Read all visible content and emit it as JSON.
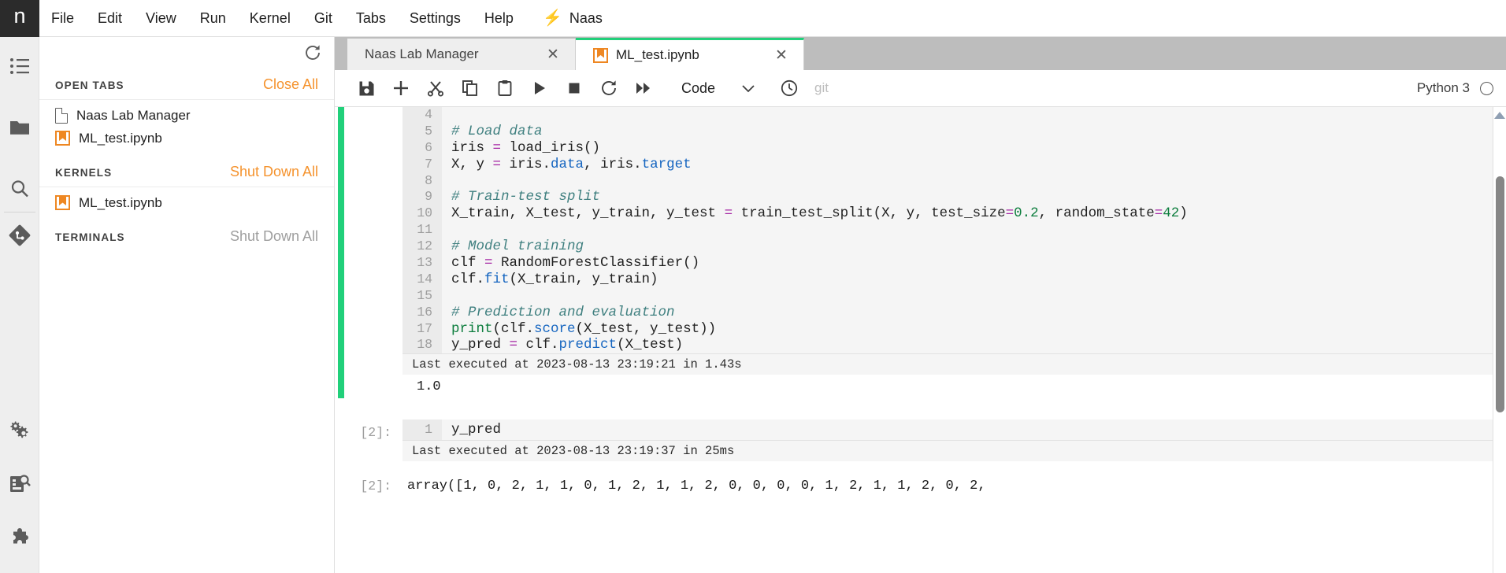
{
  "window": {
    "logo_glyph": "n"
  },
  "menubar": {
    "items": [
      {
        "label": "File"
      },
      {
        "label": "Edit"
      },
      {
        "label": "View"
      },
      {
        "label": "Run"
      },
      {
        "label": "Kernel"
      },
      {
        "label": "Git"
      },
      {
        "label": "Tabs"
      },
      {
        "label": "Settings"
      },
      {
        "label": "Help"
      }
    ],
    "naas": {
      "label": "Naas",
      "icon": "bolt-icon",
      "color": "#f5a623"
    }
  },
  "activitybar": {
    "items": [
      {
        "icon": "list-icon",
        "name": "running-terminals-and-kernels"
      },
      {
        "icon": "folder-icon",
        "name": "file-browser"
      },
      {
        "icon": "search-icon",
        "name": "search"
      },
      {
        "icon": "git-icon",
        "name": "git"
      },
      {
        "icon": "gears-icon",
        "name": "extension-settings"
      },
      {
        "icon": "property-inspector-icon",
        "name": "property-inspector"
      },
      {
        "icon": "puzzle-icon",
        "name": "extension-manager"
      }
    ]
  },
  "sidepanel": {
    "refresh_icon": "refresh-icon",
    "sections": [
      {
        "title": "OPEN TABS",
        "action": "Close All",
        "action_enabled": true,
        "items": [
          {
            "label": "Naas Lab Manager",
            "icon": "file-icon"
          },
          {
            "label": "ML_test.ipynb",
            "icon": "notebook-icon"
          }
        ]
      },
      {
        "title": "KERNELS",
        "action": "Shut Down All",
        "action_enabled": true,
        "items": [
          {
            "label": "ML_test.ipynb",
            "icon": "notebook-icon"
          }
        ]
      },
      {
        "title": "TERMINALS",
        "action": "Shut Down All",
        "action_enabled": false,
        "items": []
      }
    ]
  },
  "main": {
    "tabs": [
      {
        "label": "Naas Lab Manager",
        "icon": "none",
        "active": false,
        "close": "✕"
      },
      {
        "label": "ML_test.ipynb",
        "icon": "notebook-icon",
        "active": true,
        "close": "✕"
      }
    ],
    "toolbar": {
      "buttons": [
        {
          "name": "save-button",
          "icon": "save-icon"
        },
        {
          "name": "insert-cell-button",
          "icon": "plus-icon"
        },
        {
          "name": "cut-cell-button",
          "icon": "scissors-icon"
        },
        {
          "name": "copy-cell-button",
          "icon": "copy-icon"
        },
        {
          "name": "paste-cell-button",
          "icon": "paste-icon"
        },
        {
          "name": "run-cell-button",
          "icon": "play-icon"
        },
        {
          "name": "interrupt-kernel-button",
          "icon": "stop-icon"
        },
        {
          "name": "restart-kernel-button",
          "icon": "restart-icon"
        },
        {
          "name": "restart-and-run-all-button",
          "icon": "fast-forward-icon"
        }
      ],
      "cell_type": "Code",
      "cell_type_caret": "⌄",
      "history_icon": "clock-icon",
      "git_label": "git",
      "kernel_name": "Python 3",
      "kernel_status_icon": "kernel-idle-circle-icon"
    }
  },
  "notebook": {
    "cells": [
      {
        "prompt": "",
        "selected": true,
        "lines": [
          {
            "n": "4",
            "segments": [
              {
                "t": "",
                "c": ""
              }
            ]
          },
          {
            "n": "5",
            "segments": [
              {
                "t": "# Load data",
                "c": "tok-com"
              }
            ]
          },
          {
            "n": "6",
            "segments": [
              {
                "t": "iris ",
                "c": ""
              },
              {
                "t": "=",
                "c": "tok-op"
              },
              {
                "t": " load_iris()",
                "c": ""
              }
            ]
          },
          {
            "n": "7",
            "segments": [
              {
                "t": "X, y ",
                "c": ""
              },
              {
                "t": "=",
                "c": "tok-op"
              },
              {
                "t": " iris.",
                "c": ""
              },
              {
                "t": "data",
                "c": "tok-attr"
              },
              {
                "t": ", iris.",
                "c": ""
              },
              {
                "t": "target",
                "c": "tok-attr"
              }
            ]
          },
          {
            "n": "8",
            "segments": [
              {
                "t": "",
                "c": ""
              }
            ]
          },
          {
            "n": "9",
            "segments": [
              {
                "t": "# Train-test split",
                "c": "tok-com"
              }
            ]
          },
          {
            "n": "10",
            "segments": [
              {
                "t": "X_train, X_test, y_train, y_test ",
                "c": ""
              },
              {
                "t": "=",
                "c": "tok-op"
              },
              {
                "t": " train_test_split(X, y, test_size",
                "c": ""
              },
              {
                "t": "=",
                "c": "tok-op"
              },
              {
                "t": "0.2",
                "c": "tok-num"
              },
              {
                "t": ", random_state",
                "c": ""
              },
              {
                "t": "=",
                "c": "tok-op"
              },
              {
                "t": "42",
                "c": "tok-num"
              },
              {
                "t": ")",
                "c": ""
              }
            ]
          },
          {
            "n": "11",
            "segments": [
              {
                "t": "",
                "c": ""
              }
            ]
          },
          {
            "n": "12",
            "segments": [
              {
                "t": "# Model training",
                "c": "tok-com"
              }
            ]
          },
          {
            "n": "13",
            "segments": [
              {
                "t": "clf ",
                "c": ""
              },
              {
                "t": "=",
                "c": "tok-op"
              },
              {
                "t": " RandomForestClassifier()",
                "c": ""
              }
            ]
          },
          {
            "n": "14",
            "segments": [
              {
                "t": "clf.",
                "c": ""
              },
              {
                "t": "fit",
                "c": "tok-fn"
              },
              {
                "t": "(X_train, y_train)",
                "c": ""
              }
            ]
          },
          {
            "n": "15",
            "segments": [
              {
                "t": "",
                "c": ""
              }
            ]
          },
          {
            "n": "16",
            "segments": [
              {
                "t": "# Prediction and evaluation",
                "c": "tok-com"
              }
            ]
          },
          {
            "n": "17",
            "segments": [
              {
                "t": "print",
                "c": "tok-kw"
              },
              {
                "t": "(clf.",
                "c": ""
              },
              {
                "t": "score",
                "c": "tok-fn"
              },
              {
                "t": "(X_test, y_test))",
                "c": ""
              }
            ]
          },
          {
            "n": "18",
            "segments": [
              {
                "t": "y_pred ",
                "c": ""
              },
              {
                "t": "=",
                "c": "tok-op"
              },
              {
                "t": " clf.",
                "c": ""
              },
              {
                "t": "predict",
                "c": "tok-fn"
              },
              {
                "t": "(X_test)",
                "c": ""
              }
            ]
          }
        ],
        "exec_footer": "Last executed at 2023-08-13 23:19:21 in 1.43s",
        "output_prompt": "",
        "output_text": "1.0"
      },
      {
        "prompt": "[2]:",
        "selected": false,
        "lines": [
          {
            "n": "1",
            "segments": [
              {
                "t": "y_pred",
                "c": ""
              }
            ]
          }
        ],
        "exec_footer": "Last executed at 2023-08-13 23:19:37 in 25ms",
        "output_prompt": "[2]:",
        "output_text": "array([1, 0, 2, 1, 1, 0, 1, 2, 1, 1, 2, 0, 0, 0, 0, 1, 2, 1, 1, 2, 0, 2,"
      }
    ]
  },
  "colors": {
    "accent_orange": "#f5932e",
    "kernel_green": "#21d07a",
    "notebook_icon": "#ee8722",
    "comment_teal": "#408080",
    "operator_purple": "#a626a4",
    "attribute_blue": "#1565c0",
    "number_green": "#0c7d3d"
  }
}
